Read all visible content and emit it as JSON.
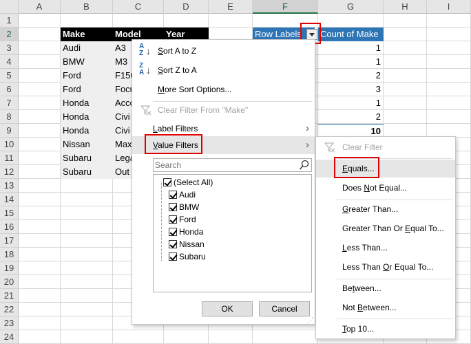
{
  "columns": [
    "A",
    "B",
    "C",
    "D",
    "E",
    "F",
    "G",
    "H",
    "I"
  ],
  "rows": [
    "1",
    "2",
    "3",
    "4",
    "5",
    "6",
    "7",
    "8",
    "9",
    "10",
    "11",
    "12",
    "13",
    "14",
    "15",
    "16",
    "17",
    "18",
    "19",
    "20",
    "21",
    "22",
    "23",
    "24"
  ],
  "table": {
    "headers": [
      "Make",
      "Model",
      "Year"
    ],
    "makes": [
      "Audi",
      "BMW",
      "Ford",
      "Ford",
      "Honda",
      "Honda",
      "Honda",
      "Nissan",
      "Subaru",
      "Subaru"
    ],
    "models": [
      "A3",
      "M3",
      "F150",
      "Focu",
      "Acco",
      "Civi",
      "Civi",
      "Max",
      "Lega",
      "Out"
    ]
  },
  "pivot": {
    "row_label_header": "Row Labels",
    "count_header": "Count of Make",
    "counts": [
      "1",
      "1",
      "2",
      "3",
      "1",
      "2"
    ],
    "grand_total": "10"
  },
  "filter_menu": {
    "sort_a_z": "Sort A to Z",
    "sort_z_a": "Sort Z to A",
    "more_sort": "More Sort Options...",
    "clear_filter": "Clear Filter From \"Make\"",
    "label_filters": "Label Filters",
    "value_filters": "Value Filters",
    "search_placeholder": "Search",
    "items": [
      "(Select All)",
      "Audi",
      "BMW",
      "Ford",
      "Honda",
      "Nissan",
      "Subaru"
    ],
    "ok": "OK",
    "cancel": "Cancel"
  },
  "value_submenu": {
    "clear_filter": "Clear Filter",
    "equals": "Equals...",
    "does_not_equal": "Does Not Equal...",
    "greater_than": "Greater Than...",
    "greater_than_or_equal": "Greater Than Or Equal To...",
    "less_than": "Less Than...",
    "less_than_or_equal": "Less Than Or Equal To...",
    "between": "Between...",
    "not_between": "Not Between...",
    "top_10": "Top 10..."
  }
}
